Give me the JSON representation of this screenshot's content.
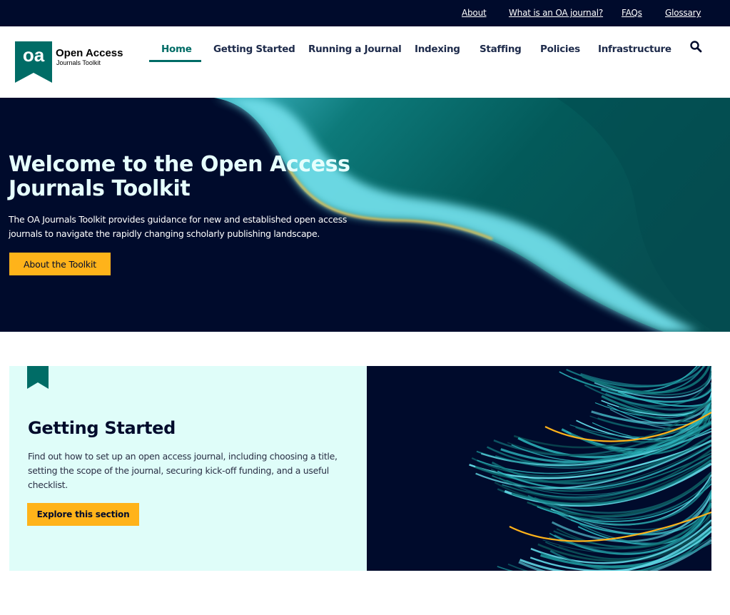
{
  "topbar": {
    "links": [
      {
        "label": "About"
      },
      {
        "label": "What is an OA journal?"
      },
      {
        "label": "FAQs"
      },
      {
        "label": "Glossary"
      }
    ]
  },
  "logo": {
    "badge_text": "oa",
    "title": "Open Access",
    "subtitle": "Journals Toolkit"
  },
  "nav": {
    "items": [
      {
        "label": "Home",
        "active": true
      },
      {
        "label": "Getting Started"
      },
      {
        "label": "Running a Journal"
      },
      {
        "label": "Indexing"
      },
      {
        "label": "Staffing"
      },
      {
        "label": "Policies"
      },
      {
        "label": "Infrastructure"
      }
    ],
    "search_icon": "search-icon"
  },
  "hero": {
    "title": "Welcome to the Open Access Journals Toolkit",
    "description": "The OA Journals Toolkit provides guidance for new and established open access journals to navigate the rapidly changing scholarly publishing landscape.",
    "button_label": "About the Toolkit"
  },
  "section_card": {
    "icon": "bookmark-icon",
    "title": "Getting Started",
    "description": "Find out how to set up an open access journal, including choosing a title, setting the scope of the journal, securing kick-off funding, and a useful checklist.",
    "button_label": "Explore this section"
  },
  "colors": {
    "navy": "#000b2c",
    "teal": "#006c66",
    "accent_yellow": "#ffb31a",
    "card_bg": "#dffdf9",
    "cyan_highlight": "#6fdde8"
  }
}
